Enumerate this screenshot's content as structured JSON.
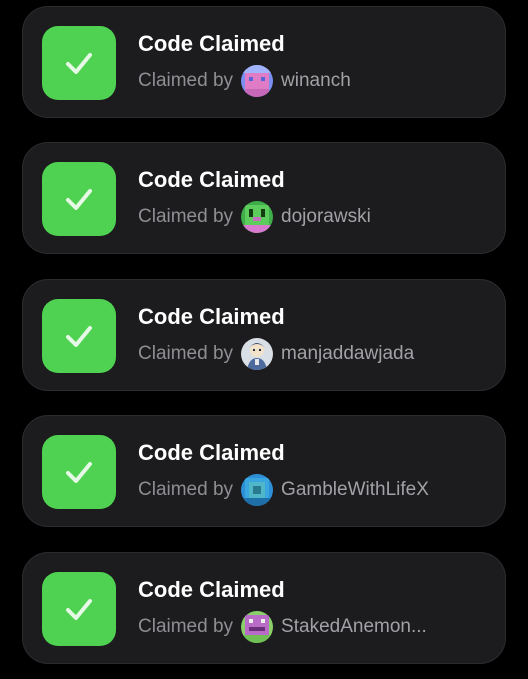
{
  "claims": [
    {
      "title": "Code Claimed",
      "claimed_by_label": "Claimed by",
      "username": "winanch",
      "avatar": "pixel-avatar-pink-blue"
    },
    {
      "title": "Code Claimed",
      "claimed_by_label": "Claimed by",
      "username": "dojorawski",
      "avatar": "pixel-avatar-green-pink"
    },
    {
      "title": "Code Claimed",
      "claimed_by_label": "Claimed by",
      "username": "manjaddawjada",
      "avatar": "photo-avatar-character"
    },
    {
      "title": "Code Claimed",
      "claimed_by_label": "Claimed by",
      "username": "GambleWithLifeX",
      "avatar": "pixel-avatar-blue-teal"
    },
    {
      "title": "Code Claimed",
      "claimed_by_label": "Claimed by",
      "username": "StakedAnemon...",
      "avatar": "pixel-avatar-purple-green"
    }
  ],
  "colors": {
    "background": "#000000",
    "card": "#1c1c1e",
    "check_tile": "#4fd152",
    "title_text": "#ffffff",
    "secondary_text": "#8e8e93"
  },
  "icons": {
    "status": "checkmark-icon"
  }
}
